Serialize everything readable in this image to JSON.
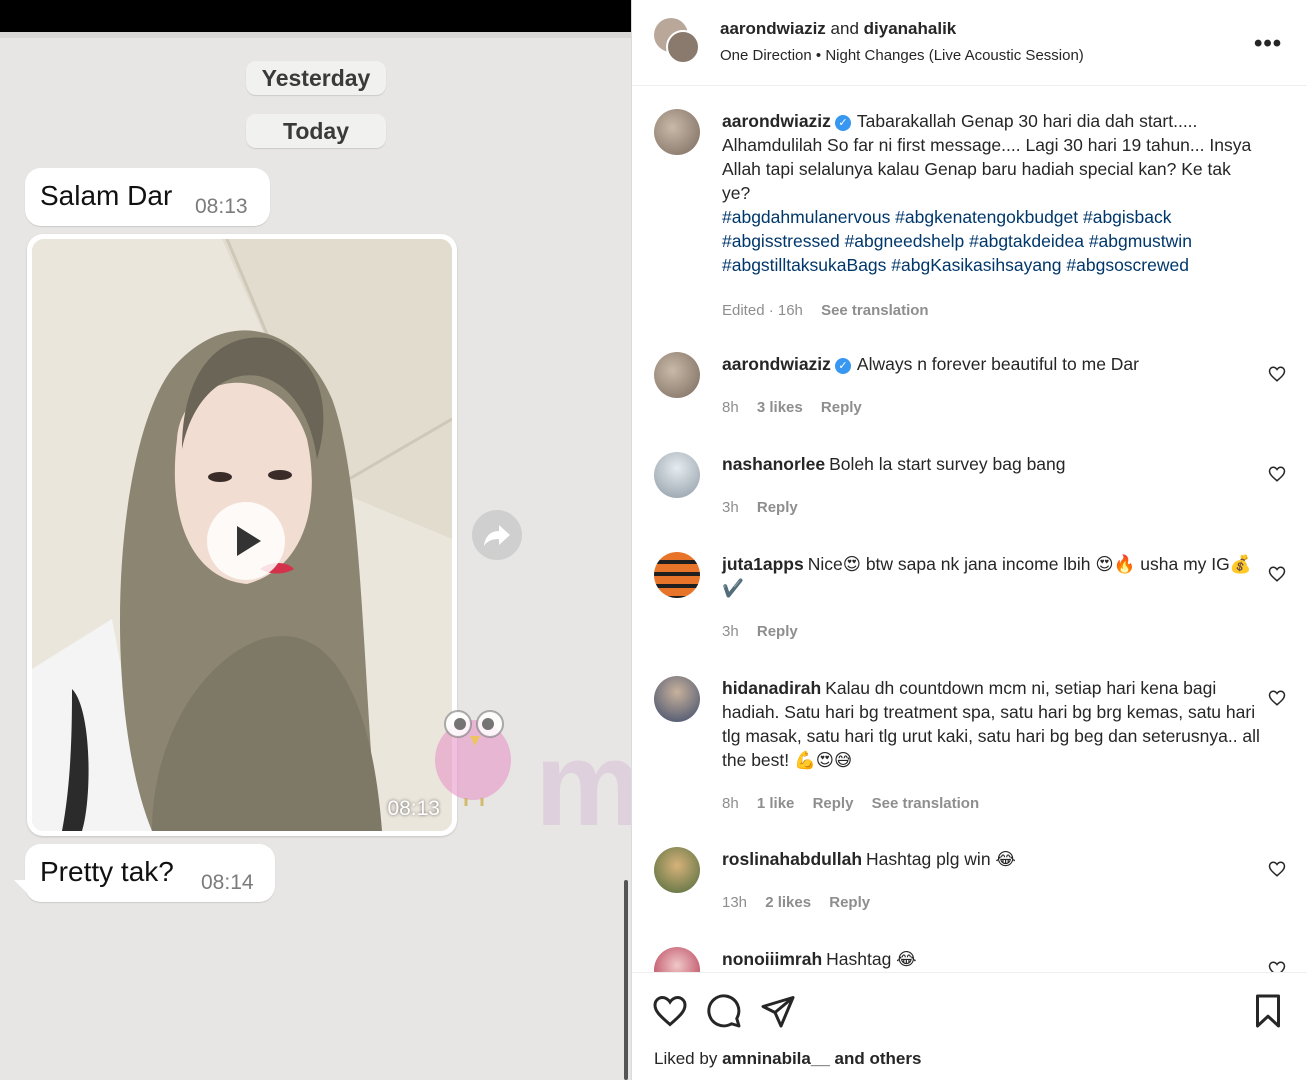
{
  "chat": {
    "date_yesterday": "Yesterday",
    "date_today": "Today",
    "messages": [
      {
        "text": "Salam Dar",
        "time": "08:13"
      },
      {
        "text": "Pretty tak?",
        "time": "08:14"
      }
    ],
    "video": {
      "time": "08:13"
    },
    "watermark": "murai"
  },
  "post": {
    "header": {
      "user1": "aarondwiaziz",
      "and": "and",
      "user2": "diyanahalik",
      "artist": "One Direction",
      "separator": "•",
      "song": "Night Changes (Live Acoustic Session)",
      "more": "•••"
    },
    "caption": {
      "user": "aarondwiaziz",
      "text": "Tabarakallah Genap 30 hari dia dah start..... Alhamdulilah So far ni first message.... Lagi 30 hari 19 tahun... Insya Allah tapi selalunya kalau Genap baru hadiah special kan? Ke tak ye?",
      "hashtags": "#abgdahmulanervous #abgkenatengokbudget #abgisback #abgisstressed #abgneedshelp #abgtakdeidea #abgmustwin #abgstilltaksukaBags #abgKasikasihsayang #abgsoscrewed",
      "edited": "Edited · 16h",
      "see_translation": "See translation"
    },
    "comments": [
      {
        "user": "aarondwiaziz",
        "text": "Always n forever beautiful to me Dar",
        "time": "8h",
        "likes": "3 likes",
        "reply": "Reply"
      },
      {
        "user": "nashanorlee",
        "text": "Boleh la start survey bag bang",
        "time": "3h",
        "reply": "Reply"
      },
      {
        "user": "juta1apps",
        "text": "Nice😍 btw sapa nk jana income lbih 😍🔥 usha my IG💰✔️",
        "time": "3h",
        "reply": "Reply"
      },
      {
        "user": "hidanadirah",
        "text": "Kalau dh countdown mcm ni, setiap hari kena bagi hadiah. Satu hari bg treatment spa, satu hari bg brg kemas, satu hari tlg masak, satu hari tlg urut kaki, satu hari bg beg dan seterusnya.. all the best! 💪😍😅",
        "time": "8h",
        "likes": "1 like",
        "reply": "Reply",
        "see_translation": "See translation"
      },
      {
        "user": "roslinahabdullah",
        "text": "Hashtag plg win 😂",
        "time": "13h",
        "likes": "2 likes",
        "reply": "Reply"
      },
      {
        "user": "nonoiiimrah",
        "text": "Hashtag 😂"
      }
    ],
    "footer": {
      "liked_by": "Liked by",
      "liker": "amninabila__",
      "and_others": "and others"
    }
  },
  "colors": {
    "hashtag": "#00376b",
    "verified": "#3897f0",
    "muted": "#8e8e8e"
  }
}
